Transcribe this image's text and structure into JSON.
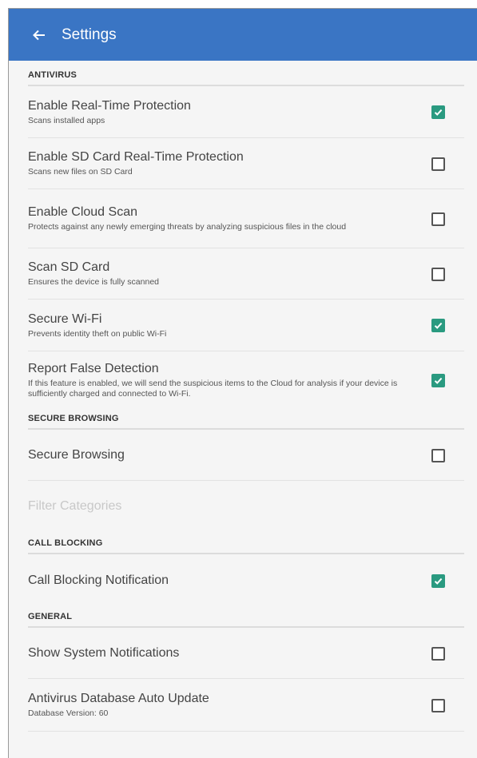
{
  "appbar": {
    "title": "Settings",
    "back_icon": "arrow-left-icon",
    "color": "#3a75c4"
  },
  "accent": "#2a9a80",
  "sections": {
    "antivirus": {
      "header": "ANTIVIRUS",
      "items": [
        {
          "label": "Enable Real-Time Protection",
          "sub": "Scans installed apps",
          "checked": true
        },
        {
          "label": "Enable SD Card Real-Time Protection",
          "sub": "Scans new files on SD Card",
          "checked": false
        },
        {
          "label": "Enable Cloud Scan",
          "sub": "Protects against any newly emerging threats by analyzing suspicious files in the cloud",
          "checked": false
        },
        {
          "label": "Scan SD Card",
          "sub": "Ensures the device is fully scanned",
          "checked": false
        },
        {
          "label": "Secure Wi-Fi",
          "sub": "Prevents identity theft on public Wi-Fi",
          "checked": true
        },
        {
          "label": "Report False Detection",
          "sub": "If this feature is enabled, we will send the suspicious items to the Cloud for analysis if your device is sufficiently charged and connected to Wi-Fi.",
          "checked": true
        }
      ]
    },
    "secure_browsing": {
      "header": "SECURE BROWSING",
      "items": [
        {
          "label": "Secure Browsing",
          "checked": false
        },
        {
          "label": "Filter Categories",
          "disabled": true
        }
      ]
    },
    "call_blocking": {
      "header": "CALL BLOCKING",
      "items": [
        {
          "label": "Call Blocking Notification",
          "checked": true
        }
      ]
    },
    "general": {
      "header": "GENERAL",
      "items": [
        {
          "label": "Show System Notifications",
          "checked": false
        },
        {
          "label": "Antivirus Database Auto Update",
          "sub": "Database Version: 60",
          "checked": false
        }
      ]
    }
  }
}
